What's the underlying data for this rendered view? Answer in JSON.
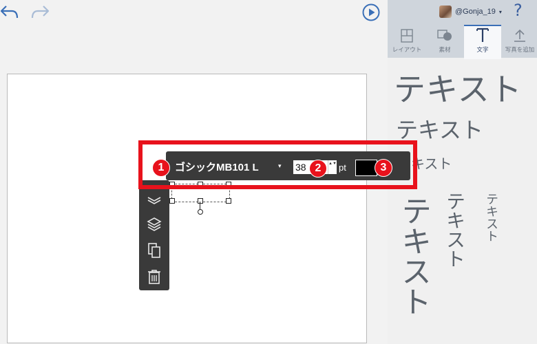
{
  "toolbar": {
    "undo_icon": "undo-arrow",
    "redo_icon": "redo-arrow",
    "play_icon": "play-circle"
  },
  "user": {
    "name": "@Gonja_19",
    "caret": "▾",
    "help": "?"
  },
  "tabs": [
    {
      "label": "レイアウト",
      "icon": "layout-icon"
    },
    {
      "label": "素材",
      "icon": "material-icon"
    },
    {
      "label": "文字",
      "icon": "text-icon",
      "active": true
    },
    {
      "label": "写真を追加",
      "icon": "upload-icon"
    }
  ],
  "text_samples": {
    "large": "テキスト",
    "medium": "テキスト",
    "small": "テキスト",
    "vertical_large": "テキスト",
    "vertical_medium": "テキスト",
    "vertical_small": "テキスト"
  },
  "font_toolbar": {
    "font_name": "ゴシックMB101 L",
    "font_caret": "▾",
    "size": "38",
    "stepper": "▲▼",
    "unit": "pt",
    "color": "#000000"
  },
  "annotations": {
    "marker1": "1",
    "marker2": "2",
    "marker3": "3",
    "frame_color": "#e8121c"
  }
}
